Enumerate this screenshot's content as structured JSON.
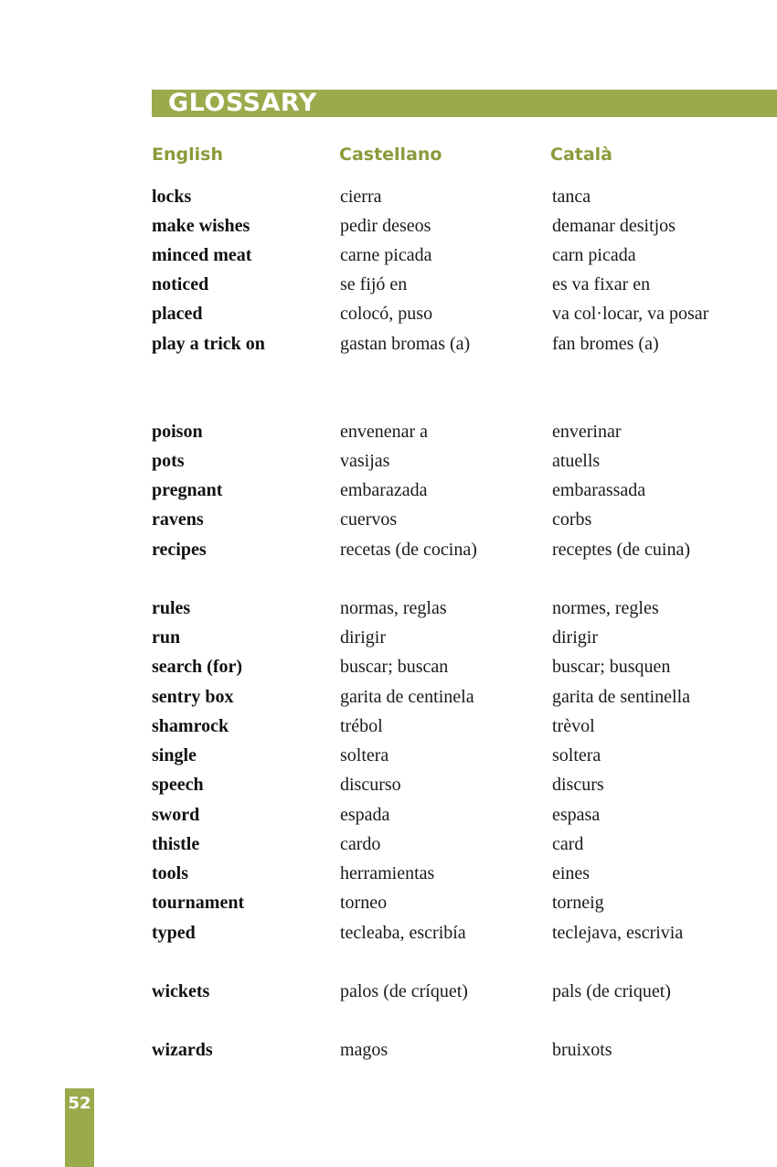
{
  "header": {
    "title": "GLOSSARY"
  },
  "columns": {
    "english": "English",
    "castellano": "Castellano",
    "catala": "Català"
  },
  "entries": [
    {
      "en": "locks",
      "es": "cierra",
      "ca": "tanca"
    },
    {
      "en": "make wishes",
      "es": "pedir deseos",
      "ca": "demanar desitjos"
    },
    {
      "en": "minced meat",
      "es": "carne picada",
      "ca": "carn picada"
    },
    {
      "en": "noticed",
      "es": "se fijó en",
      "ca": "es va fixar en"
    },
    {
      "en": "placed",
      "es": "colocó, puso",
      "ca": "va col·locar, va posar"
    },
    {
      "en": "play a trick on",
      "es": "gastan bromas (a)",
      "ca": "fan bromes (a)"
    },
    {
      "en": "poison",
      "es": "envenenar a",
      "ca": "enverinar"
    },
    {
      "en": "pots",
      "es": "vasijas",
      "ca": "atuells"
    },
    {
      "en": "pregnant",
      "es": "embarazada",
      "ca": "embarassada"
    },
    {
      "en": "ravens",
      "es": "cuervos",
      "ca": "corbs"
    },
    {
      "en": "recipes",
      "es": "recetas (de cocina)",
      "ca": "receptes (de cuina)"
    },
    {
      "en": "rules",
      "es": "normas, reglas",
      "ca": "normes, regles"
    },
    {
      "en": "run",
      "es": "dirigir",
      "ca": "dirigir"
    },
    {
      "en": "search (for)",
      "es": "buscar; buscan",
      "ca": "buscar; busquen"
    },
    {
      "en": "sentry box",
      "es": "garita de centinela",
      "ca": "garita de sentinella"
    },
    {
      "en": "shamrock",
      "es": "trébol",
      "ca": "trèvol"
    },
    {
      "en": "single",
      "es": "soltera",
      "ca": "soltera"
    },
    {
      "en": "speech",
      "es": "discurso",
      "ca": "discurs"
    },
    {
      "en": "sword",
      "es": "espada",
      "ca": "espasa"
    },
    {
      "en": "thistle",
      "es": "cardo",
      "ca": "card"
    },
    {
      "en": "tools",
      "es": "herramientas",
      "ca": "eines"
    },
    {
      "en": "tournament",
      "es": "torneo",
      "ca": "torneig"
    },
    {
      "en": "typed",
      "es": "tecleaba, escribía",
      "ca": "teclejava, escrivia"
    },
    {
      "en": "wickets",
      "es": "palos (de críquet)",
      "ca": "pals (de criquet)"
    },
    {
      "en": "wizards",
      "es": "magos",
      "ca": "bruixots"
    }
  ],
  "page_number": "52",
  "colors": {
    "accent": "#9aab4c",
    "header_text": "#8a9b3a"
  }
}
